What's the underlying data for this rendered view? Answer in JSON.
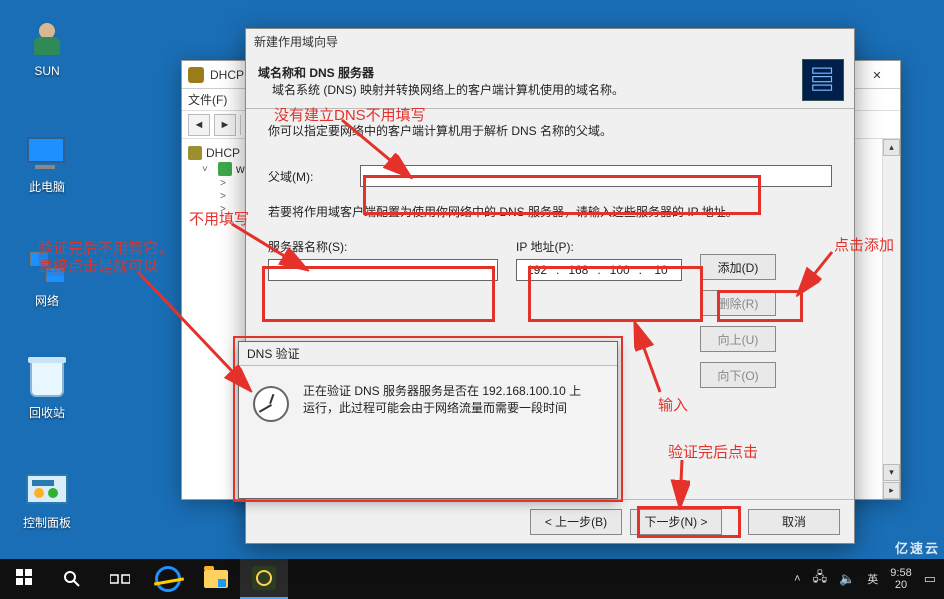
{
  "desktop": {
    "icons": [
      "SUN",
      "此电脑",
      "网络",
      "回收站",
      "控制面板"
    ]
  },
  "dhcp_window": {
    "title": "DHCP",
    "menu": {
      "file": "文件(F)"
    },
    "tree": {
      "root": "DHCP",
      "server": "win"
    }
  },
  "wizard": {
    "window_title": "新建作用域向导",
    "header_title": "域名称和 DNS 服务器",
    "header_sub": "域名系统 (DNS) 映射并转换网络上的客户端计算机使用的域名称。",
    "instruction": "你可以指定要网络中的客户端计算机用于解析 DNS 名称的父域。",
    "parent_domain_label": "父域(M):",
    "parent_domain_value": "",
    "hint": "若要将作用域客户端配置为使用你网络中的 DNS 服务器，请输入这些服务器的 IP 地址。",
    "server_name_label": "服务器名称(S):",
    "server_name_value": "",
    "ip_label": "IP 地址(P):",
    "ip_value": {
      "a": "192",
      "b": "168",
      "c": "100",
      "d": "10"
    },
    "buttons": {
      "add": "添加(D)",
      "remove": "删除(R)",
      "up": "向上(U)",
      "down": "向下(O)"
    },
    "footer": {
      "back": "< 上一步(B)",
      "next": "下一步(N) >",
      "cancel": "取消"
    }
  },
  "verify_popup": {
    "title": "DNS 验证",
    "line1": "正在验证 DNS 服务器服务是否在 192.168.100.10 上",
    "line2": "运行，此过程可能会由于网络流量而需要一段时间"
  },
  "annotations": {
    "no_dns": "没有建立DNS不用填写",
    "no_fill": "不用填写",
    "input": "输入",
    "click_add": "点击添加",
    "after_verify_click": "验证完后点击",
    "verify_skip_1": "验证完后不用管它，",
    "verify_skip_2": "直接点击是就可以"
  },
  "taskbar": {
    "ime": "英",
    "time": "9:58",
    "date": "20"
  },
  "watermark": "亿速云"
}
